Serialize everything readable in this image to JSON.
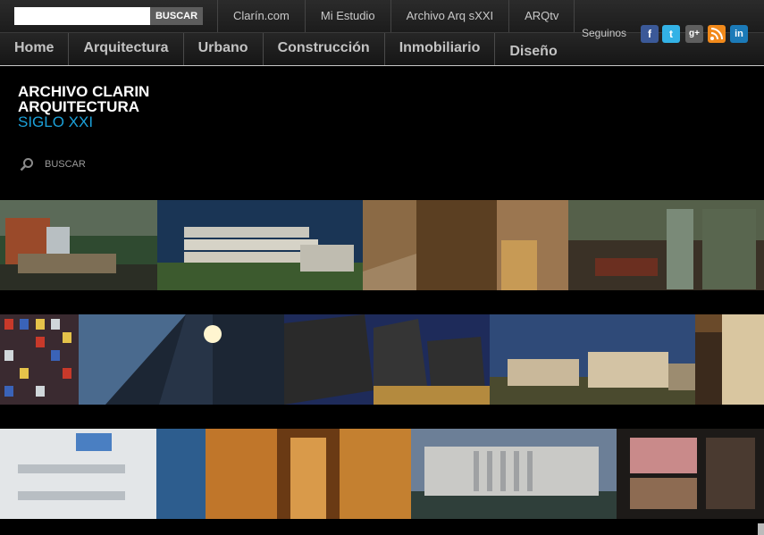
{
  "header": {
    "search_button": "BUSCAR",
    "search_placeholder": "",
    "links": [
      "Clarín.com",
      "Mi Estudio",
      "Archivo Arq sXXI",
      "ARQtv"
    ]
  },
  "nav": {
    "items": [
      "Home",
      "Arquitectura",
      "Urbano",
      "Construcción",
      "Inmobiliario",
      "Diseño"
    ]
  },
  "social": {
    "label": "Seguinos",
    "icons": [
      "facebook-icon",
      "twitter-icon",
      "google-plus-icon",
      "rss-icon",
      "linkedin-icon"
    ]
  },
  "logo": {
    "line1": "ARCHIVO CLARIN",
    "line2": "ARQUITECTURA",
    "line3": "SIGLO XXI"
  },
  "sidebar_search": {
    "label": "BUSCAR"
  },
  "colors": {
    "accent": "#1ca0d8",
    "facebook": "#3b5998",
    "twitter": "#33b2e6",
    "google": "#5f5f5f",
    "rss": "#f28a1b",
    "linkedin": "#1b7ab8"
  }
}
